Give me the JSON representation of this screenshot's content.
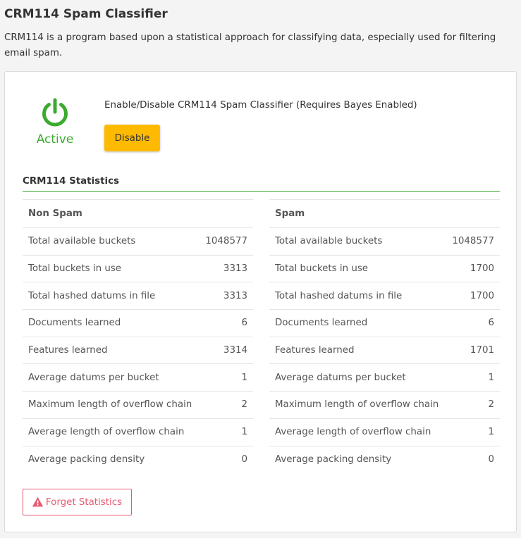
{
  "page": {
    "title": "CRM114 Spam Classifier",
    "description": "CRM114 is a program based upon a statistical approach for classifying data, especially used for filtering email spam."
  },
  "status": {
    "icon": "power-icon",
    "label": "Active",
    "color": "#3bab2f"
  },
  "toggle": {
    "description": "Enable/Disable CRM114 Spam Classifier (Requires Bayes Enabled)",
    "button_label": "Disable",
    "button_color": "#fdba00"
  },
  "statistics": {
    "heading": "CRM114 Statistics",
    "accent_color": "#3bab2f",
    "non_spam": {
      "header": "Non Spam",
      "rows": [
        {
          "label": "Total available buckets",
          "value": "1048577"
        },
        {
          "label": "Total buckets in use",
          "value": "3313"
        },
        {
          "label": "Total hashed datums in file",
          "value": "3313"
        },
        {
          "label": "Documents learned",
          "value": "6"
        },
        {
          "label": "Features learned",
          "value": "3314"
        },
        {
          "label": "Average datums per bucket",
          "value": "1"
        },
        {
          "label": "Maximum length of overflow chain",
          "value": "2"
        },
        {
          "label": "Average length of overflow chain",
          "value": "1"
        },
        {
          "label": "Average packing density",
          "value": "0"
        }
      ]
    },
    "spam": {
      "header": "Spam",
      "rows": [
        {
          "label": "Total available buckets",
          "value": "1048577"
        },
        {
          "label": "Total buckets in use",
          "value": "1700"
        },
        {
          "label": "Total hashed datums in file",
          "value": "1700"
        },
        {
          "label": "Documents learned",
          "value": "6"
        },
        {
          "label": "Features learned",
          "value": "1701"
        },
        {
          "label": "Average datums per bucket",
          "value": "1"
        },
        {
          "label": "Maximum length of overflow chain",
          "value": "2"
        },
        {
          "label": "Average length of overflow chain",
          "value": "1"
        },
        {
          "label": "Average packing density",
          "value": "0"
        }
      ]
    }
  },
  "forget": {
    "icon": "warning-icon",
    "label": "Forget Statistics",
    "color": "#e85a73"
  }
}
